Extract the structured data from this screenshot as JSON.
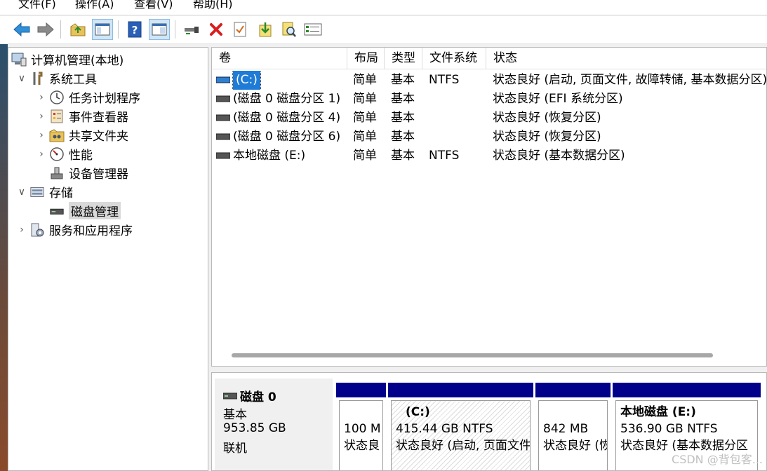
{
  "menu": [
    "文件(F)",
    "操作(A)",
    "查看(V)",
    "帮助(H)"
  ],
  "toolbar": {
    "icons": [
      "back-arrow-icon",
      "forward-arrow-icon",
      "up-folder-icon",
      "show-hide-tree-icon",
      "help-icon",
      "console-view-icon",
      "connect-icon",
      "delete-icon",
      "check-icon",
      "import-icon",
      "search-icon",
      "properties-icon"
    ]
  },
  "tree": {
    "root": "计算机管理(本地)",
    "system_tools": "系统工具",
    "task_scheduler": "任务计划程序",
    "event_viewer": "事件查看器",
    "shared_folders": "共享文件夹",
    "performance": "性能",
    "device_manager": "设备管理器",
    "storage": "存储",
    "disk_management": "磁盘管理",
    "services_apps": "服务和应用程序"
  },
  "volumes": {
    "columns": [
      "卷",
      "布局",
      "类型",
      "文件系统",
      "状态"
    ],
    "rows": [
      {
        "name": "(C:)",
        "layout": "简单",
        "type": "基本",
        "fs": "NTFS",
        "status": "状态良好 (启动, 页面文件, 故障转储, 基本数据分区)"
      },
      {
        "name": "(磁盘 0 磁盘分区 1)",
        "layout": "简单",
        "type": "基本",
        "fs": "",
        "status": "状态良好 (EFI 系统分区)"
      },
      {
        "name": "(磁盘 0 磁盘分区 4)",
        "layout": "简单",
        "type": "基本",
        "fs": "",
        "status": "状态良好 (恢复分区)"
      },
      {
        "name": "(磁盘 0 磁盘分区 6)",
        "layout": "简单",
        "type": "基本",
        "fs": "",
        "status": "状态良好 (恢复分区)"
      },
      {
        "name": "本地磁盘 (E:)",
        "layout": "简单",
        "type": "基本",
        "fs": "NTFS",
        "status": "状态良好 (基本数据分区)"
      }
    ]
  },
  "disk": {
    "name": "磁盘 0",
    "type": "基本",
    "size": "953.85 GB",
    "status": "联机",
    "partitions": [
      {
        "title": "",
        "size": "100 M",
        "status": "状态良"
      },
      {
        "title": "(C:)",
        "size": "415.44 GB NTFS",
        "status": "状态良好 (启动, 页面文件"
      },
      {
        "title": "",
        "size": "842 MB",
        "status": "状态良好 (恢"
      },
      {
        "title": "本地磁盘  (E:)",
        "size": "536.90 GB NTFS",
        "status": "状态良好 (基本数据分区"
      }
    ]
  },
  "watermark": "CSDN @背包客..."
}
